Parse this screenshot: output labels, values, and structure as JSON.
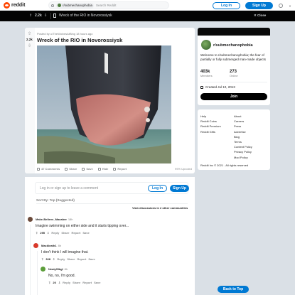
{
  "header": {
    "brand": "reddit",
    "search_chip": "r/submechanophobia",
    "search_placeholder": "Search Reddit",
    "login_label": "Log In",
    "signup_label": "Sign Up"
  },
  "postbar": {
    "score": "2.2k",
    "title": "Wreck of the RIO in Novorossiysk",
    "close_label": "Close"
  },
  "post": {
    "score": "2.2k",
    "meta": "Posted by u/TheWolvesAtBing 18 hours ago",
    "title": "Wreck of the RIO in Novorossiysk",
    "comments_label": "47 Comments",
    "share_label": "Share",
    "save_label": "Save",
    "hide_label": "Hide",
    "report_label": "Report",
    "upvoted_label": "99% Upvoted"
  },
  "comment_box": {
    "prompt": "Log in or sign up to leave a comment",
    "login_label": "Log In",
    "signup_label": "Sign Up",
    "sort_label": "Sort By: Top (Suggested)",
    "view_all": "View discussions in 2 other communities"
  },
  "comments": [
    {
      "user": "Make-Believe_Macabre",
      "time": "18h",
      "body": "Imagine swimming on either side and it starts tipping over...",
      "score": "295",
      "actions": [
        "Reply",
        "Share",
        "Report",
        "Save"
      ],
      "avatar_color": "#6b4a3a"
    },
    {
      "user": "Mackleath1",
      "time": "8h",
      "body": "I don't think I will imagine that.",
      "score": "328",
      "actions": [
        "Reply",
        "Share",
        "Report",
        "Save"
      ],
      "avatar_color": "#d93a2b"
    },
    {
      "user": "NeatySlbgl",
      "time": "8h",
      "body": "No, no, I'm good.",
      "score": "20",
      "actions": [
        "Reply",
        "Share",
        "Report",
        "Save"
      ],
      "avatar_color": "#5c9e3a"
    }
  ],
  "sidebar": {
    "name": "r/submechanophobia",
    "description": "Welcome to r/submechanophobia; the fear of partially or fully submerged man-made objects",
    "members": "403k",
    "members_label": "Members",
    "online": "273",
    "online_label": "Online",
    "created": "Created Jul 10, 2013",
    "join_label": "Join"
  },
  "footer": {
    "col1": [
      "Help",
      "Reddit Coins",
      "Reddit Premium",
      "Reddit Gifts"
    ],
    "col2": [
      "About",
      "Careers",
      "Press",
      "Advertise",
      "Blog",
      "Terms",
      "Content Policy",
      "Privacy Policy",
      "Mod Policy"
    ],
    "copyright": "Reddit Inc © 2021 . All rights reserved"
  },
  "back_to_top": "Back to Top",
  "colors": {
    "accent": "#0079d3",
    "brand": "#ff4500"
  }
}
